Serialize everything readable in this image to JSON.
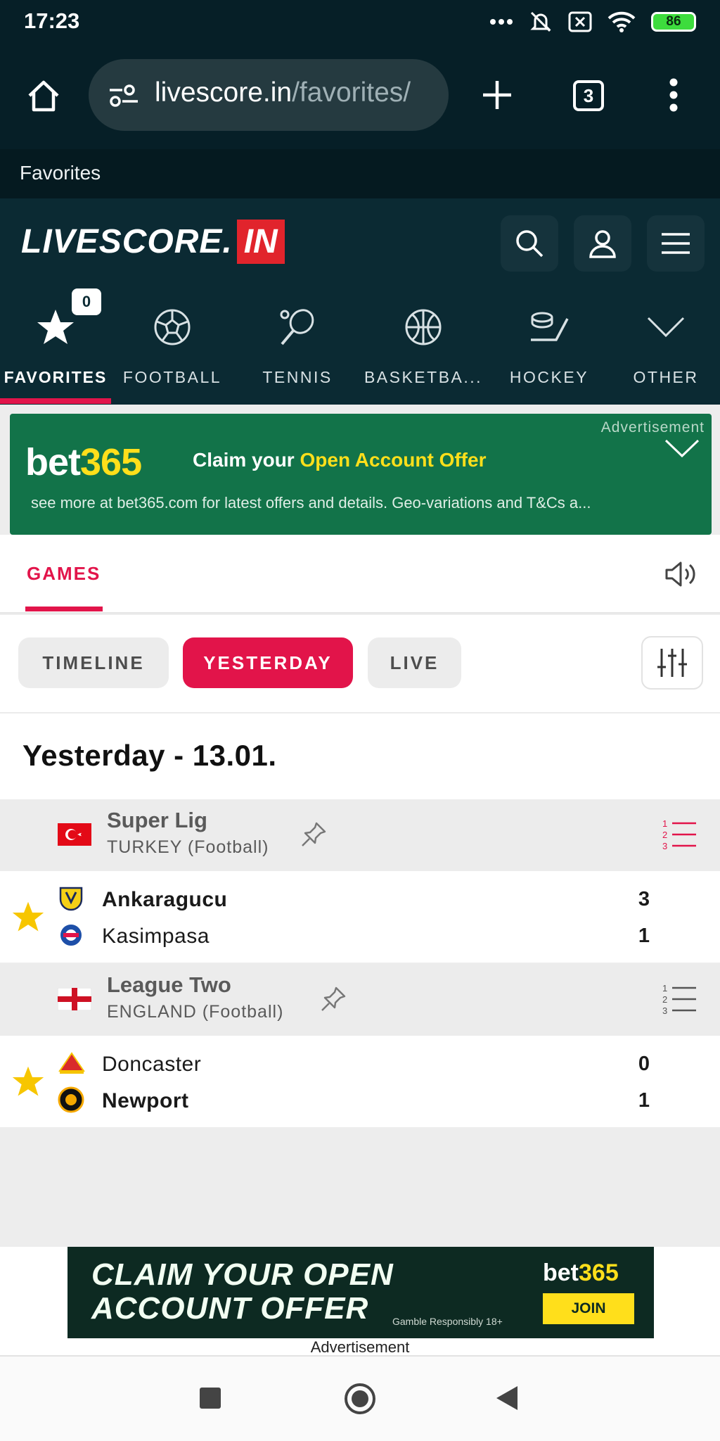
{
  "status": {
    "time": "17:23",
    "battery": "86"
  },
  "browser": {
    "url_host": "livescore.in",
    "url_path": "/favorites/",
    "tab_count": "3",
    "page_title": "Favorites"
  },
  "site": {
    "logo_main": "LIVESCORE.",
    "logo_badge": "IN",
    "sports": [
      {
        "label": "FAVORITES",
        "icon": "star-icon",
        "badge": "0"
      },
      {
        "label": "FOOTBALL",
        "icon": "football-icon"
      },
      {
        "label": "TENNIS",
        "icon": "tennis-icon"
      },
      {
        "label": "BASKETBA...",
        "icon": "basketball-icon"
      },
      {
        "label": "HOCKEY",
        "icon": "hockey-icon"
      },
      {
        "label": "OTHER",
        "icon": "chevron-down-icon"
      }
    ]
  },
  "ad_top": {
    "label": "Advertisement",
    "brand_a": "bet",
    "brand_b": "365",
    "claim_a": "Claim your ",
    "claim_b": "Open Account Offer",
    "sub": "see more at bet365.com for latest offers and details. Geo-variations and T&Cs a..."
  },
  "tabs": {
    "games": "GAMES"
  },
  "filters": [
    "TIMELINE",
    "YESTERDAY",
    "LIVE"
  ],
  "date_title": "Yesterday - 13.01.",
  "leagues": [
    {
      "name": "Super Lig",
      "country": "TURKEY (Football)",
      "matches": [
        {
          "home": "Ankaragucu",
          "away": "Kasimpasa",
          "home_score": "3",
          "away_score": "1"
        }
      ]
    },
    {
      "name": "League Two",
      "country": "ENGLAND (Football)",
      "matches": [
        {
          "home": "Doncaster",
          "away": "Newport",
          "home_score": "0",
          "away_score": "1"
        }
      ]
    }
  ],
  "ad_bottom": {
    "line1": "CLAIM YOUR OPEN",
    "line2": "ACCOUNT OFFER",
    "brand_a": "bet",
    "brand_b": "365",
    "join": "JOIN",
    "gamble": "Gamble Responsibly  18+",
    "label": "Advertisement"
  },
  "colors": {
    "accent": "#e2144a",
    "header_bg": "#0b2a33",
    "ad_green": "#127349",
    "star": "#f7c600"
  }
}
